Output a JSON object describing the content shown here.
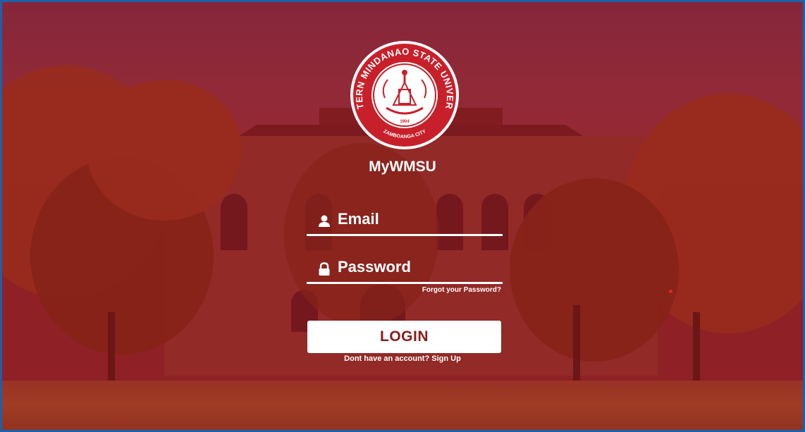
{
  "app": {
    "brand_name": "MyWMSU",
    "logo": {
      "top_arc_text": "WESTERN MINDANAO STATE UNIVERSITY",
      "year": "1904",
      "city": "ZAMBOANGA CITY"
    }
  },
  "form": {
    "email_label": "Email",
    "password_label": "Password",
    "forgot_link": "Forgot your Password?",
    "login_button": "LOGIN",
    "signup_prompt": "Dont have an account?",
    "signup_link": "Sign Up"
  },
  "colors": {
    "overlay": "#96141e",
    "button_text": "#8a1c1c",
    "frame_border": "#1f5fa8"
  },
  "icons": {
    "email": "user-icon",
    "password": "lock-icon"
  }
}
